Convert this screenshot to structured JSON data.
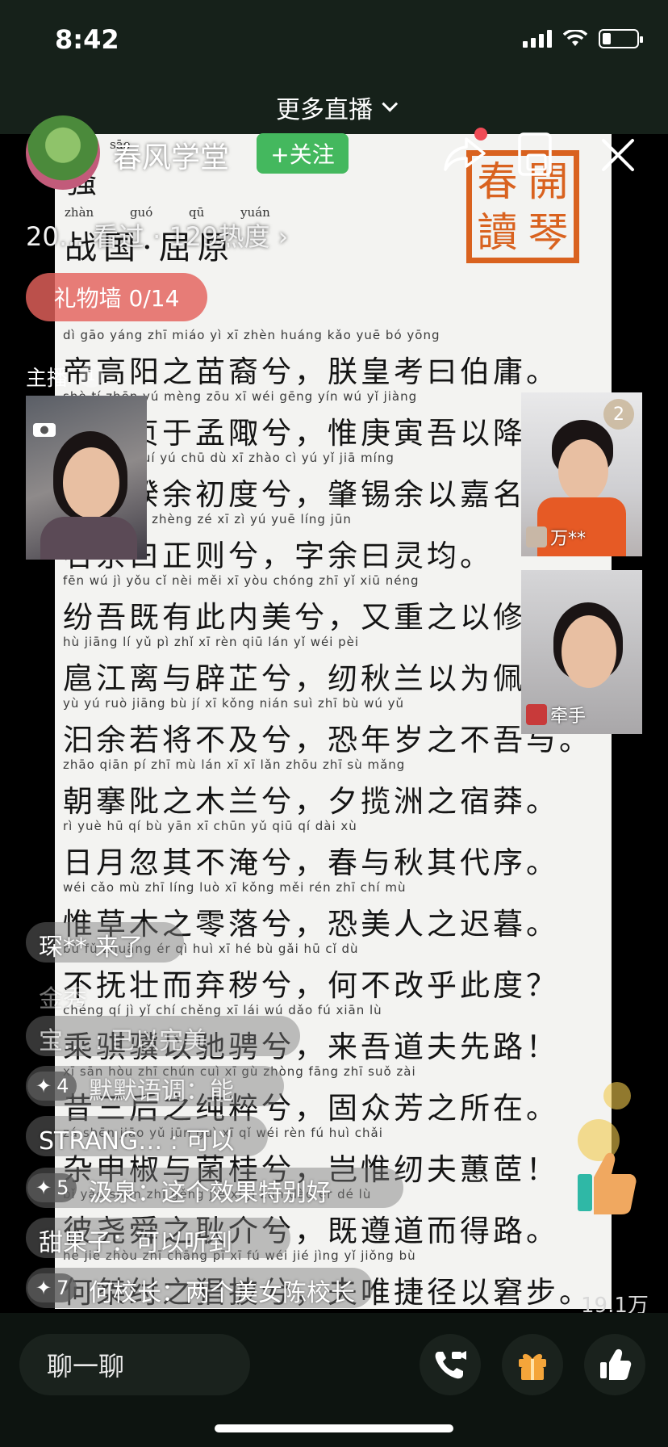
{
  "status_bar": {
    "time": "8:42",
    "battery_level": 0.25
  },
  "top_nav": {
    "more_live_label": "更多直播"
  },
  "streamer": {
    "channel_name": "春风学堂",
    "follow_label": "+关注",
    "stats_text": "20… 看过 · 129热度 ›",
    "gift_wall_label": "礼物墙 0/14",
    "host_label": "主播",
    "host_badge": "1"
  },
  "document": {
    "title": "骚",
    "title_pinyin": "sāo",
    "author_pinyin": [
      "zhàn",
      "guó",
      "qū",
      "yuán"
    ],
    "author": "战国·屈原",
    "seal_chars": [
      "開",
      "春",
      "琴",
      "讀"
    ],
    "lines": [
      {
        "pinyin": "dì gāo yáng zhī miáo yì xī zhèn huáng kǎo yuē bó yōng",
        "text": "帝高阳之苗裔兮，朕皇考曰伯庸。"
      },
      {
        "pinyin": "shè tí zhēn yú mèng zōu xī wéi gēng yín wú yǐ jiàng",
        "text": "摄提贞于孟陬兮，惟庚寅吾以降。"
      },
      {
        "pinyin": "huáng lǎn kuí yú chū dù xī zhào cì yú yǐ jiā míng",
        "text": "皇览揆余初度兮，肇锡余以嘉名。"
      },
      {
        "pinyin": "míng yú yuē zhèng zé xī zì yú yuē líng jūn",
        "text": "名余曰正则兮，字余曰灵均。"
      },
      {
        "pinyin": "fēn wú jì yǒu cǐ nèi měi xī yòu chóng zhī yǐ xiū néng",
        "text": "纷吾既有此内美兮，又重之以修能。"
      },
      {
        "pinyin": "hù jiāng lí yǔ pì zhǐ xī rèn qiū lán yǐ wéi pèi",
        "text": "扈江离与辟芷兮，纫秋兰以为佩。"
      },
      {
        "pinyin": "yù yú ruò jiāng bù jí xī kǒng nián suì zhī bù wú yǔ",
        "text": "汩余若将不及兮，恐年岁之不吾与。"
      },
      {
        "pinyin": "zhāo qiān pí zhī mù lán xī xī lǎn zhōu zhī sù mǎng",
        "text": "朝搴阰之木兰兮，夕揽洲之宿莽。"
      },
      {
        "pinyin": "rì yuè hū qí bù yān xī chūn yǔ qiū qí dài xù",
        "text": "日月忽其不淹兮，春与秋其代序。"
      },
      {
        "pinyin": "wéi cǎo mù zhī líng luò xī kǒng měi rén zhī chí mù",
        "text": "惟草木之零落兮，恐美人之迟暮。"
      },
      {
        "pinyin": "bù fǔ zhuàng ér qì huì xī hé bù gǎi hū cǐ dù",
        "text": "不抚壮而弃秽兮，何不改乎此度？"
      },
      {
        "pinyin": "chéng qí jì yǐ chí chěng xī lái wú dǎo fú xiān lù",
        "text": "乘骐骥以驰骋兮，来吾道夫先路！"
      },
      {
        "pinyin": "xī sān hòu zhī chún cuì xī gù zhòng fāng zhī suǒ zài",
        "text": "昔三后之纯粹兮，固众芳之所在。"
      },
      {
        "pinyin": "zá shēn jiāo yǔ jūn guì xī qǐ wéi rèn fú huì chǎi",
        "text": "杂申椒与菌桂兮，岂惟纫夫蕙茝！"
      },
      {
        "pinyin": "bǐ yáo shùn zhī gěng jiè xī jì zūn dào ér dé lù",
        "text": "彼尧舜之耿介兮，既遵道而得路。"
      },
      {
        "pinyin": "hé jié zhòu zhī chāng pī xī fú wéi jié jìng yǐ jiǒng bù",
        "text": "何桀纣之猖披兮，夫唯捷径以窘步。"
      }
    ]
  },
  "guests": [
    {
      "number": "2",
      "name": "万**"
    },
    {
      "name": "牵手"
    }
  ],
  "chat": {
    "join_message": "琛** 来了",
    "messages": [
      {
        "text": "金秀"
      },
      {
        "text": "宝… : 已以完美"
      },
      {
        "level": "4",
        "text": "默默语调：能"
      },
      {
        "text": "STRANG… : 可以"
      },
      {
        "level": "5",
        "text": "汲泉：这个效果特别好"
      },
      {
        "text": "甜果子：可以听到"
      },
      {
        "level": "7",
        "text": "何校长：两个美女陈校长"
      }
    ],
    "viewer_count": "19.1万"
  },
  "bottom_bar": {
    "chat_placeholder": "聊一聊"
  },
  "colors": {
    "follow_green": "#44b85e",
    "gift_wall": "#e4625c",
    "seal_orange": "#d9621f",
    "background": "#0b0f0c"
  }
}
